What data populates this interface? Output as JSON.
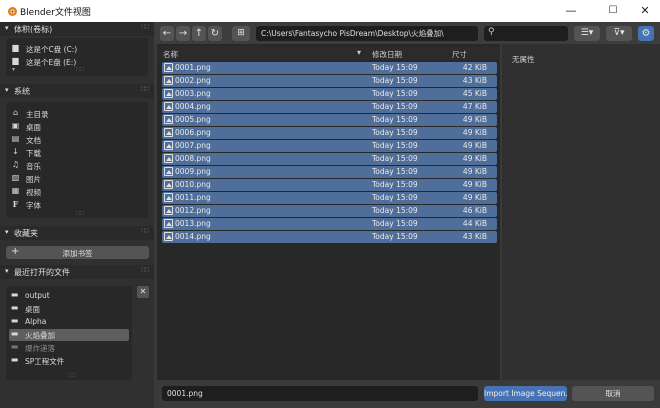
{
  "window": {
    "title": "Blender文件视图",
    "minimize": "—",
    "maximize": "☐",
    "close": "✕"
  },
  "sidebar": {
    "volumes": {
      "header": "体积(卷标)",
      "items": [
        {
          "label": "这是个C盘 (C:)",
          "icon": "drive-icon"
        },
        {
          "label": "这是个E盘 (E:)",
          "icon": "drive-icon"
        }
      ]
    },
    "system": {
      "header": "系统",
      "items": [
        {
          "label": "主目录",
          "icon": "home-icon"
        },
        {
          "label": "桌面",
          "icon": "desktop-icon"
        },
        {
          "label": "文档",
          "icon": "document-icon"
        },
        {
          "label": "下载",
          "icon": "download-icon"
        },
        {
          "label": "音乐",
          "icon": "music-icon"
        },
        {
          "label": "图片",
          "icon": "image-icon"
        },
        {
          "label": "视频",
          "icon": "video-icon"
        },
        {
          "label": "字体",
          "icon": "font-icon"
        }
      ]
    },
    "bookmarks": {
      "header": "收藏夹",
      "add_label": "添加书签"
    },
    "recent": {
      "header": "最近打开的文件",
      "items": [
        {
          "label": "output",
          "selected": false,
          "dim": false
        },
        {
          "label": "桌面",
          "selected": false,
          "dim": false
        },
        {
          "label": "Alpha",
          "selected": false,
          "dim": false
        },
        {
          "label": "火焰叠加",
          "selected": true,
          "dim": false
        },
        {
          "label": "爆炸递落",
          "selected": false,
          "dim": true
        },
        {
          "label": "SP工程文件",
          "selected": false,
          "dim": false
        }
      ]
    }
  },
  "toolbar": {
    "path": "C:\\Users\\Fantasycho PisDream\\Desktop\\火焰叠加\\"
  },
  "columns": {
    "name": "名称",
    "date": "修改日期",
    "size": "尺寸"
  },
  "files": [
    {
      "name": "0001.png",
      "date": "Today 15:09",
      "size": "42 KiB"
    },
    {
      "name": "0002.png",
      "date": "Today 15:09",
      "size": "43 KiB"
    },
    {
      "name": "0003.png",
      "date": "Today 15:09",
      "size": "45 KiB"
    },
    {
      "name": "0004.png",
      "date": "Today 15:09",
      "size": "47 KiB"
    },
    {
      "name": "0005.png",
      "date": "Today 15:09",
      "size": "49 KiB"
    },
    {
      "name": "0006.png",
      "date": "Today 15:09",
      "size": "49 KiB"
    },
    {
      "name": "0007.png",
      "date": "Today 15:09",
      "size": "49 KiB"
    },
    {
      "name": "0008.png",
      "date": "Today 15:09",
      "size": "49 KiB"
    },
    {
      "name": "0009.png",
      "date": "Today 15:09",
      "size": "49 KiB"
    },
    {
      "name": "0010.png",
      "date": "Today 15:09",
      "size": "49 KiB"
    },
    {
      "name": "0011.png",
      "date": "Today 15:09",
      "size": "49 KiB"
    },
    {
      "name": "0012.png",
      "date": "Today 15:09",
      "size": "46 KiB"
    },
    {
      "name": "0013.png",
      "date": "Today 15:09",
      "size": "44 KiB"
    },
    {
      "name": "0014.png",
      "date": "Today 15:09",
      "size": "43 KiB"
    }
  ],
  "properties": {
    "empty_label": "无属性"
  },
  "footer": {
    "filename": "0001.png",
    "confirm_label": "Import Image Sequen...",
    "cancel_label": "取消"
  },
  "colors": {
    "selection": "#4f6e9a",
    "accent": "#4772b3",
    "background": "#282828"
  }
}
